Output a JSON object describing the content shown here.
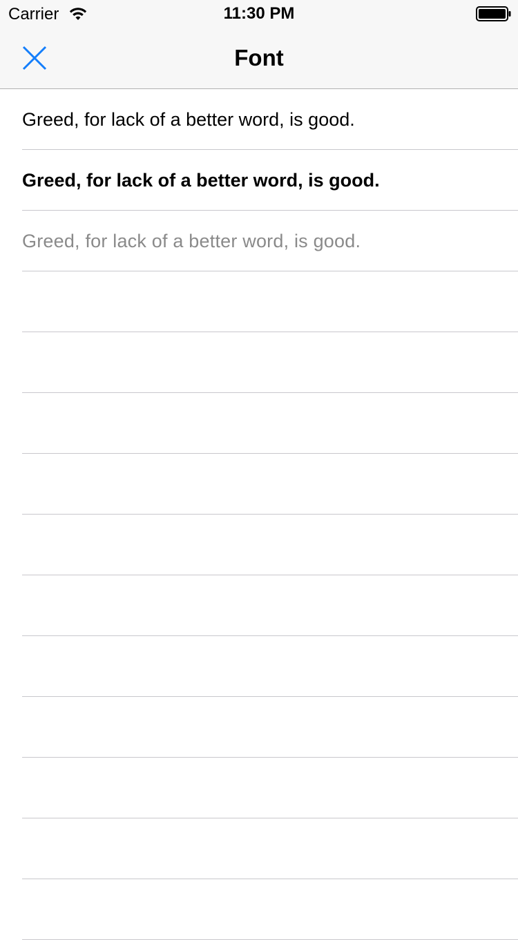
{
  "status_bar": {
    "carrier": "Carrier",
    "time": "11:30 PM",
    "wifi_icon": "wifi-icon",
    "battery_icon": "battery-icon"
  },
  "nav_bar": {
    "title": "Font",
    "close_icon": "close-icon",
    "accent_color": "#147efb"
  },
  "font_list": {
    "rows": [
      {
        "label": "Greed, for lack of a better word, is good.",
        "style": "regular"
      },
      {
        "label": "Greed, for lack of a better word, is good.",
        "style": "bold"
      },
      {
        "label": "Greed, for lack of a better word, is good.",
        "style": "light"
      },
      {
        "label": "",
        "style": "empty"
      },
      {
        "label": "",
        "style": "empty"
      },
      {
        "label": "",
        "style": "empty"
      },
      {
        "label": "",
        "style": "empty"
      },
      {
        "label": "",
        "style": "empty"
      },
      {
        "label": "",
        "style": "empty"
      },
      {
        "label": "",
        "style": "empty"
      },
      {
        "label": "",
        "style": "empty"
      },
      {
        "label": "",
        "style": "empty"
      },
      {
        "label": "",
        "style": "empty"
      },
      {
        "label": "",
        "style": "empty"
      }
    ]
  }
}
